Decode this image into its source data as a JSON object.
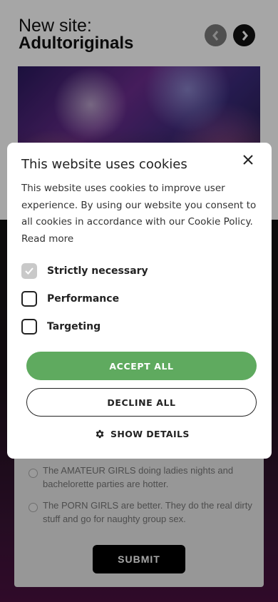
{
  "header": {
    "title_line1": "New site:",
    "title_line2": "Adultoriginals"
  },
  "hero": {
    "image_alt": "party crowd photo"
  },
  "poll": {
    "options": [
      "The AMATEUR GIRLS doing ladies nights and bachelorette parties are hotter.",
      "The PORN GIRLS are better. They do the real dirty stuff and go for naughty group sex."
    ],
    "submit_label": "SUBMIT"
  },
  "cookie_modal": {
    "title": "This website uses cookies",
    "description": "This website uses cookies to improve user experience. By using our website you consent to all cookies in accordance with our Cookie Policy.",
    "read_more": "Read more",
    "options": [
      {
        "label": "Strictly necessary",
        "checked": true,
        "disabled": true
      },
      {
        "label": "Performance",
        "checked": false
      },
      {
        "label": "Targeting",
        "checked": false
      }
    ],
    "accept_label": "ACCEPT ALL",
    "decline_label": "DECLINE ALL",
    "details_label": "SHOW DETAILS"
  },
  "colors": {
    "accept": "#5faa5f",
    "nav_prev": "#7a7a7a",
    "nav_next": "#111111"
  },
  "icons": [
    "chevron-left-icon",
    "chevron-right-icon",
    "close-icon",
    "checkmark-icon",
    "gear-icon"
  ]
}
